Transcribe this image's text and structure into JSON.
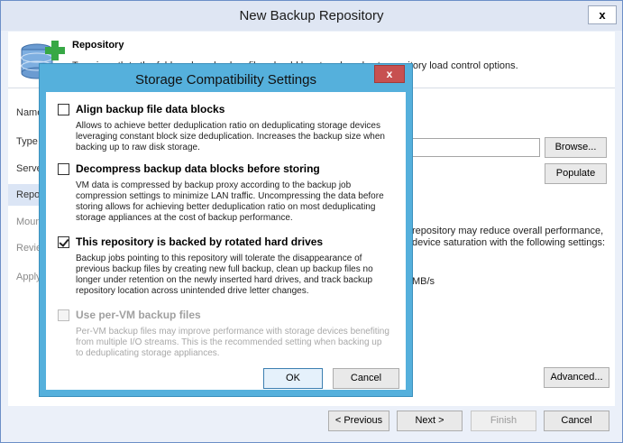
{
  "window": {
    "title": "New Backup Repository",
    "close_glyph": "x",
    "header_title": "Repository",
    "header_desc": "Type in path to the folder where backup files should be stored, and set repository load control options."
  },
  "nav": {
    "items": [
      {
        "label": "Name",
        "state": "normal"
      },
      {
        "label": "Type",
        "state": "normal"
      },
      {
        "label": "Server",
        "state": "normal"
      },
      {
        "label": "Repository",
        "state": "active"
      },
      {
        "label": "Mount Server",
        "state": "dim"
      },
      {
        "label": "Review",
        "state": "dim"
      },
      {
        "label": "Apply",
        "state": "dim"
      }
    ]
  },
  "main": {
    "browse_label": "Browse...",
    "populate_label": "Populate",
    "load_text_1": "repository may reduce overall performance,",
    "load_text_2": "device saturation with the following settings:",
    "rate_unit": "MB/s",
    "advanced_label": "Advanced..."
  },
  "footer": {
    "previous_label": "< Previous",
    "next_label": "Next >",
    "finish_label": "Finish",
    "cancel_label": "Cancel"
  },
  "dialog": {
    "title": "Storage Compatibility Settings",
    "close_glyph": "x",
    "options": [
      {
        "label": "Align backup file data blocks",
        "checked": false,
        "enabled": true,
        "desc": "Allows to achieve better deduplication ratio on deduplicating storage devices leveraging constant block size deduplication. Increases the backup size when backing up to raw disk storage."
      },
      {
        "label": "Decompress backup data blocks before storing",
        "checked": false,
        "enabled": true,
        "desc": "VM data is compressed by backup proxy according to the backup job compression settings to minimize LAN traffic. Uncompressing the data before storing allows for achieving better deduplication ratio on most deduplicating storage appliances at the cost of backup performance."
      },
      {
        "label": "This repository is backed by rotated hard drives",
        "checked": true,
        "enabled": true,
        "desc": "Backup jobs pointing to this repository will tolerate the disappearance of previous backup files by creating new full backup, clean up backup files no longer under retention on the newly inserted hard drives, and track backup repository location across unintended drive letter changes."
      },
      {
        "label": "Use per-VM backup files",
        "checked": false,
        "enabled": false,
        "desc": "Per-VM backup files may improve performance with storage devices benefiting from multiple I/O streams. This is the recommended setting when backing up to deduplicating storage appliances."
      }
    ],
    "ok_label": "OK",
    "cancel_label": "Cancel"
  },
  "colors": {
    "dialog_frame": "#55b0dc",
    "dialog_close": "#c75050",
    "window_chrome": "#ebf0f9"
  }
}
